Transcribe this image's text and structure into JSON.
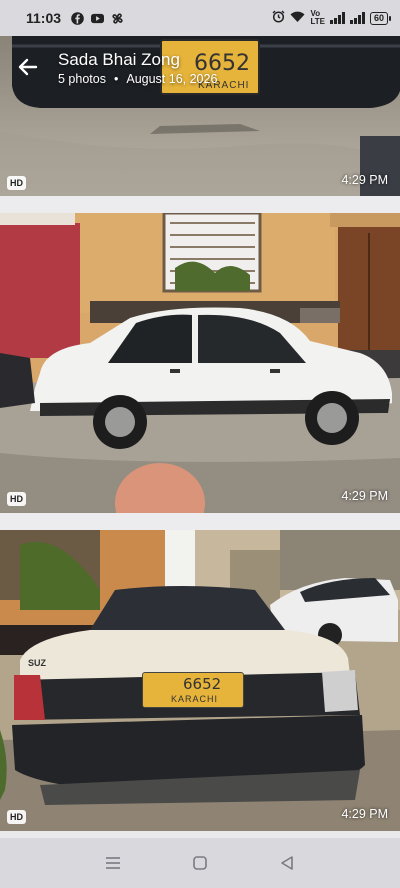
{
  "status_bar": {
    "time": "11:03",
    "battery": "60",
    "icons": [
      "facebook-icon",
      "youtube-icon",
      "fan-icon",
      "alarm-icon",
      "wifi-icon",
      "volte-icon",
      "signal-icon"
    ]
  },
  "header": {
    "title": "Sada Bhai Zong",
    "photo_count": "5 photos",
    "separator": "•",
    "date": "August 16, 2026"
  },
  "photos": [
    {
      "badge": "HD",
      "time": "4:29 PM",
      "plate": "6652",
      "plate_city": "KARACHI"
    },
    {
      "badge": "HD",
      "time": "4:29 PM"
    },
    {
      "badge": "HD",
      "time": "4:29 PM",
      "plate": "6652",
      "plate_city": "KARACHI",
      "brand": "SUZ"
    }
  ],
  "nav": [
    "menu-icon",
    "home-icon",
    "back-icon"
  ],
  "colors": {
    "status_bg": "#d9d9de",
    "nav_bg": "#d8d8dd",
    "plate_yellow": "#e6b43a"
  }
}
